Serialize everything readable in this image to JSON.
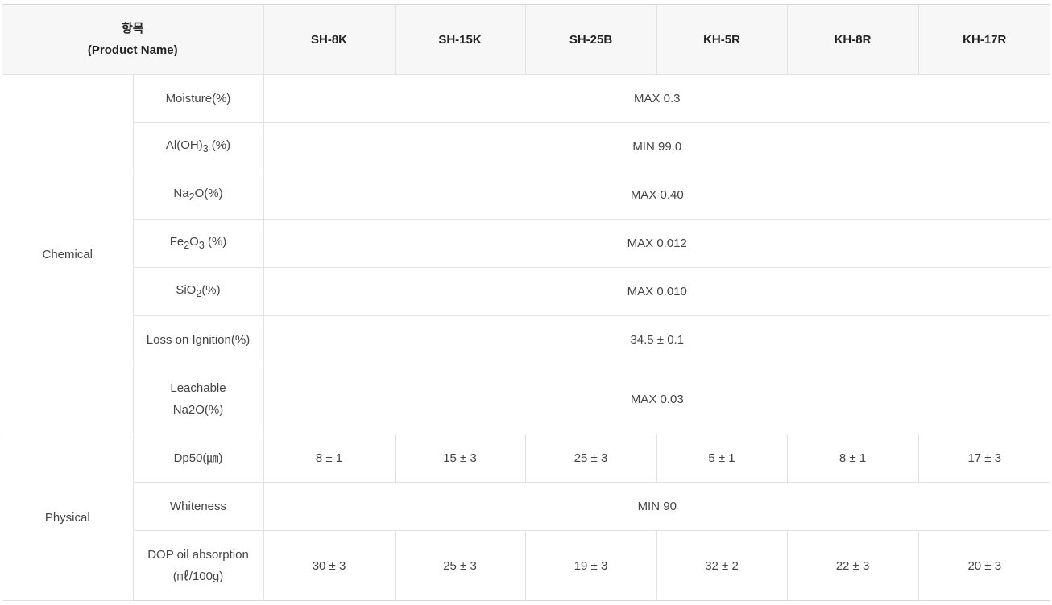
{
  "header": {
    "item_label_ko": "항목",
    "item_label_en": "(Product Name)",
    "products": [
      "SH-8K",
      "SH-15K",
      "SH-25B",
      "KH-5R",
      "KH-8R",
      "KH-17R"
    ]
  },
  "chemical": {
    "category": "Chemical",
    "rows": [
      {
        "item": "Moisture(%)",
        "value": "MAX 0.3"
      },
      {
        "item_pre": "Al(OH)",
        "item_sub": "3",
        "item_post": " (%)",
        "value": "MIN 99.0"
      },
      {
        "item_pre": "Na",
        "item_sub": "2",
        "item_post": "O(%)",
        "value": "MAX 0.40"
      },
      {
        "item_pre": "Fe",
        "item_sub": "2",
        "item_mid": "O",
        "item_sub2": "3",
        "item_post": " (%)",
        "value": "MAX 0.012"
      },
      {
        "item_pre": "SiO",
        "item_sub": "2",
        "item_post": "(%)",
        "value": "MAX 0.010"
      },
      {
        "item": "Loss on Ignition(%)",
        "value": "34.5 ± 0.1"
      },
      {
        "item_line1": "Leachable",
        "item_line2": "Na2O(%)",
        "value": "MAX 0.03"
      }
    ]
  },
  "physical": {
    "category": "Physical",
    "dp50": {
      "item": "Dp50(㎛)",
      "values": [
        "8 ± 1",
        "15 ± 3",
        "25 ± 3",
        "5 ± 1",
        "8 ± 1",
        "17 ± 3"
      ]
    },
    "whiteness": {
      "item": "Whiteness",
      "value": "MIN 90"
    },
    "dop": {
      "item_line1": "DOP oil absorption",
      "item_line2": "(㎖/100g)",
      "values": [
        "30 ± 3",
        "25 ± 3",
        "19 ± 3",
        "32 ± 2",
        "22 ± 3",
        "20 ± 3"
      ]
    }
  }
}
